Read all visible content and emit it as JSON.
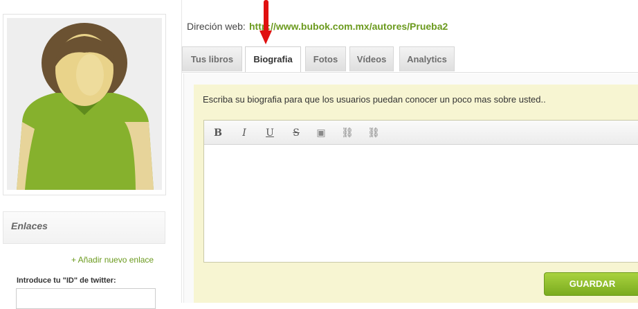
{
  "sidebar": {
    "links_title": "Enlaces",
    "add_link_label": "+ Añadir nuevo enlace",
    "twitter_label": "Introduce tu \"ID\" de twitter:",
    "twitter_value": ""
  },
  "profile": {
    "web_label": "Direción web:",
    "web_url": "http://www.bubok.com.mx/autores/Prueba2"
  },
  "tabs": [
    {
      "label": "Tus libros",
      "active": false
    },
    {
      "label": "Biografia",
      "active": true
    },
    {
      "label": "Fotos",
      "active": false
    },
    {
      "label": "Vídeos",
      "active": false
    },
    {
      "label": "Analytics",
      "active": false
    }
  ],
  "biography": {
    "instructions": "Escriba su biografia para que los usuarios puedan conocer un poco mas sobre usted..",
    "content": "",
    "toolbar": [
      {
        "icon": "bold-icon",
        "glyph": "B"
      },
      {
        "icon": "italic-icon",
        "glyph": "I"
      },
      {
        "icon": "underline-icon",
        "glyph": "U"
      },
      {
        "icon": "strikethrough-icon",
        "glyph": "S"
      },
      {
        "icon": "image-icon",
        "glyph": "▣"
      },
      {
        "icon": "link-icon",
        "glyph": "⛓"
      },
      {
        "icon": "unlink-icon",
        "glyph": "⛓"
      }
    ],
    "save_label": "GUARDAR"
  },
  "colors": {
    "accent_green": "#6b9a1e",
    "button_green": "#8cbd2c",
    "bio_background": "#f7f5d2",
    "arrow_red": "#e01010"
  }
}
